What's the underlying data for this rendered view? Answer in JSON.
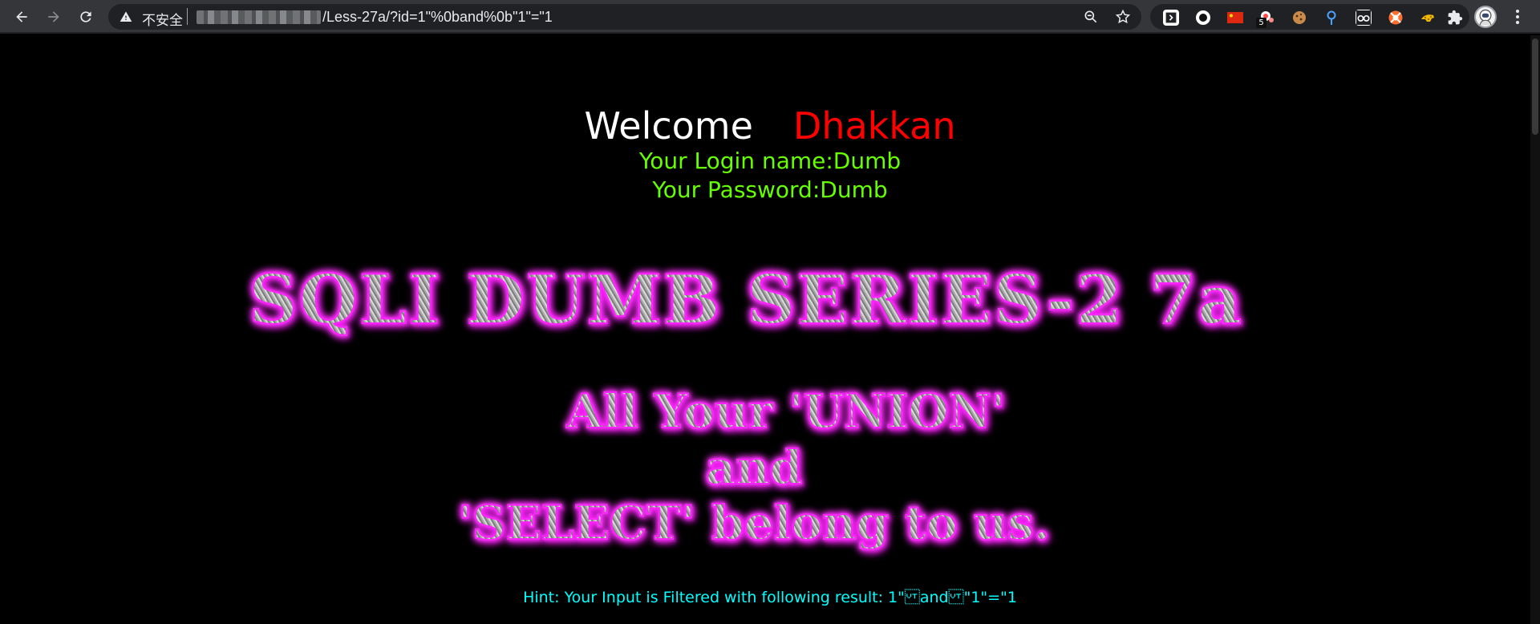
{
  "browser": {
    "security_label": "不安全",
    "url_path": "/Less-27a/?id=1\"%0band%0b\"1\"=\"1",
    "extensions": [
      {
        "icon": "sidebar-panel-icon",
        "color": "#ffffff"
      },
      {
        "icon": "record-circle-icon",
        "color": "#ffffff"
      },
      {
        "icon": "china-flag-icon",
        "color": "#de2910"
      },
      {
        "icon": "candy-icon",
        "color": "#ff5a5a"
      },
      {
        "icon": "cookie-icon",
        "color": "#c98a4a"
      },
      {
        "icon": "location-pin-icon",
        "color": "#4aa3ff"
      },
      {
        "icon": "glasses-icon",
        "color": "#ffffff"
      },
      {
        "icon": "lifebuoy-icon",
        "color": "#ff6d2d"
      },
      {
        "icon": "cheetah-icon",
        "color": "#f2b705"
      },
      {
        "icon": "puzzle-icon",
        "color": "#e8eaed"
      }
    ],
    "extension_badge": "5"
  },
  "page": {
    "welcome": "Welcome",
    "user": "Dhakkan",
    "login_name": "Your Login name:Dumb",
    "password": "Your Password:Dumb",
    "series_title": "SQLI DUMB SERIES-2 7a",
    "slogan_line1": "All Your 'UNION'",
    "slogan_line2": "and",
    "slogan_line3": "'SELECT' belong to us.",
    "hint_label": "Hint: Your Input is Filtered with following result:",
    "hint_value": "1\"\u000band\u000b\"1\"=\"1"
  },
  "colors": {
    "welcome": "#ffffff",
    "user": "#ff0000",
    "credentials": "#66ff00",
    "hint": "#00ffff",
    "title_glow": "#ff00ff"
  }
}
